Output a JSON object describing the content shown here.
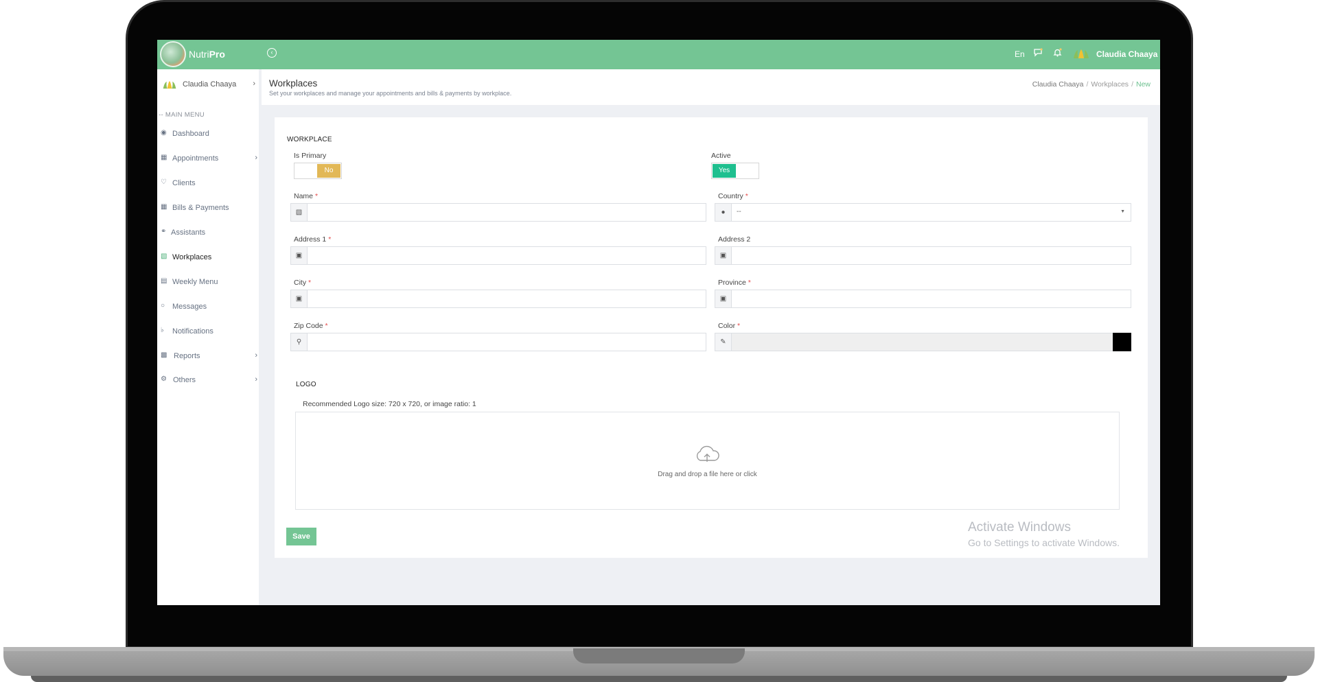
{
  "app": {
    "brand_light": "Nutri",
    "brand_bold": "Pro",
    "accent_color": "#74c594"
  },
  "topbar": {
    "language": "En",
    "user_name": "Claudia Chaaya"
  },
  "sidebar": {
    "user_name": "Claudia Chaaya",
    "menu_heading": "-- MAIN MENU",
    "items": [
      {
        "label": "Dashboard",
        "icon": "dashboard-icon"
      },
      {
        "label": "Appointments",
        "icon": "calendar-icon"
      },
      {
        "label": "Clients",
        "icon": "heart-icon"
      },
      {
        "label": "Bills & Payments",
        "icon": "calculator-icon"
      },
      {
        "label": "Assistants",
        "icon": "stethoscope-icon"
      },
      {
        "label": "Workplaces",
        "icon": "building-icon",
        "active": true
      },
      {
        "label": "Weekly Menu",
        "icon": "document-icon"
      },
      {
        "label": "Messages",
        "icon": "chat-icon"
      },
      {
        "label": "Notifications",
        "icon": "bell-icon"
      },
      {
        "label": "Reports",
        "icon": "chart-icon"
      },
      {
        "label": "Others",
        "icon": "cogs-icon"
      }
    ]
  },
  "page": {
    "title": "Workplaces",
    "subtitle": "Set your workplaces and manage your appointments and bills & payments by workplace.",
    "breadcrumb": [
      "Claudia Chaaya",
      "Workplaces",
      "New"
    ]
  },
  "form": {
    "section_title": "WORKPLACE",
    "is_primary": {
      "label": "Is Primary",
      "value": "No",
      "color": "#e2b857"
    },
    "active": {
      "label": "Active",
      "value": "Yes",
      "color": "#1fbf8f"
    },
    "name": {
      "label": "Name",
      "value": ""
    },
    "country": {
      "label": "Country",
      "value": "--"
    },
    "address1": {
      "label": "Address 1",
      "value": ""
    },
    "address2": {
      "label": "Address 2",
      "value": ""
    },
    "city": {
      "label": "City",
      "value": ""
    },
    "province": {
      "label": "Province",
      "value": ""
    },
    "zip": {
      "label": "Zip Code",
      "value": ""
    },
    "color": {
      "label": "Color",
      "value": "#000000"
    },
    "required_mark": "*",
    "logo_title": "LOGO",
    "logo_hint": "Recommended Logo size: 720 x 720, or image ratio: 1",
    "dropzone_text": "Drag and drop a file here or click",
    "save_label": "Save"
  },
  "watermark": {
    "title": "Activate Windows",
    "subtitle": "Go to Settings to activate Windows."
  }
}
